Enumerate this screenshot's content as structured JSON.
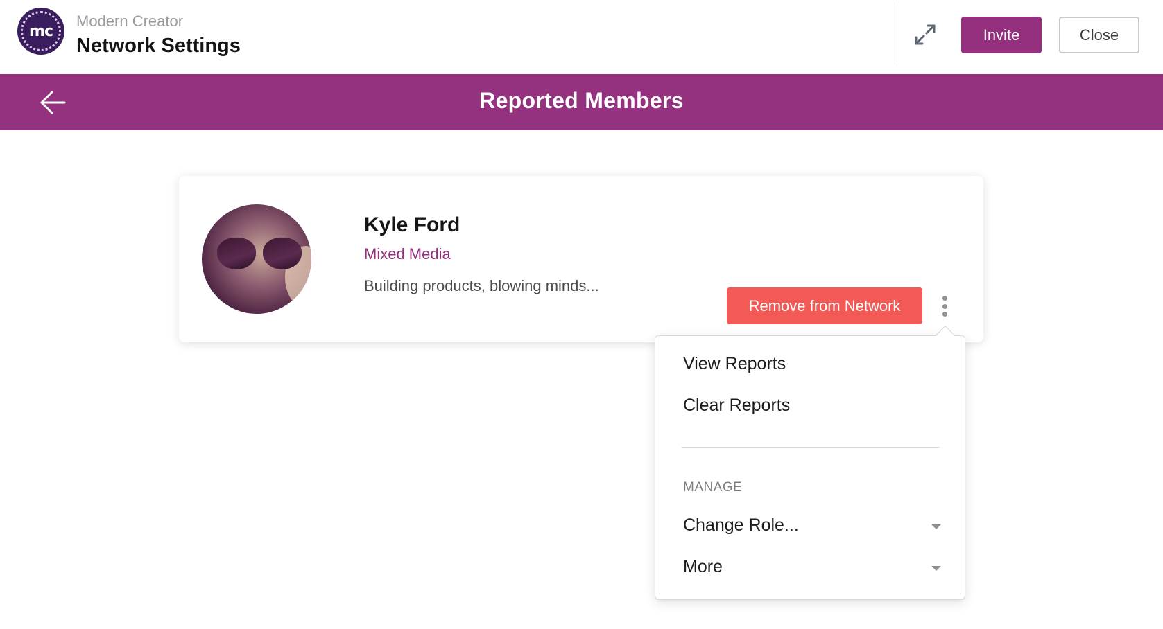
{
  "header": {
    "logo_text": "mc",
    "org_name": "Modern Creator",
    "page_name": "Network Settings",
    "expand_icon": "expand-arrows-icon",
    "invite_label": "Invite",
    "close_label": "Close",
    "accent_color": "#94307d"
  },
  "titlebar": {
    "title": "Reported Members",
    "back_icon": "arrow-left-icon",
    "background_color": "#94327f"
  },
  "member": {
    "name": "Kyle Ford",
    "category": "Mixed Media",
    "bio": "Building products, blowing minds...",
    "remove_label": "Remove from Network",
    "remove_color": "#f35a55"
  },
  "menu": {
    "view_reports": "View Reports",
    "clear_reports": "Clear Reports",
    "section_label": "MANAGE",
    "change_role": "Change Role...",
    "more": "More"
  }
}
